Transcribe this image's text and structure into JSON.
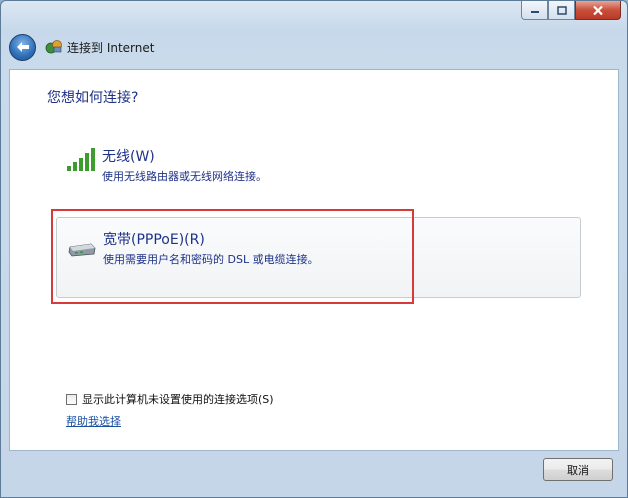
{
  "window": {
    "title": "连接到 Internet"
  },
  "heading": "您想如何连接?",
  "options": [
    {
      "icon": "wireless-signal-icon",
      "title": "无线(W)",
      "description": "使用无线路由器或无线网络连接。"
    },
    {
      "icon": "broadband-modem-icon",
      "title": "宽带(PPPoE)(R)",
      "description": "使用需要用户名和密码的 DSL 或电缆连接。"
    }
  ],
  "show_unconfigured_option": {
    "label": "显示此计算机未设置使用的连接选项(S)",
    "checked": false
  },
  "help_link": "帮助我选择",
  "buttons": {
    "cancel": "取消"
  },
  "colors": {
    "highlight": "#d63a3a",
    "link": "#1a4fa1",
    "heading": "#1e3287"
  }
}
